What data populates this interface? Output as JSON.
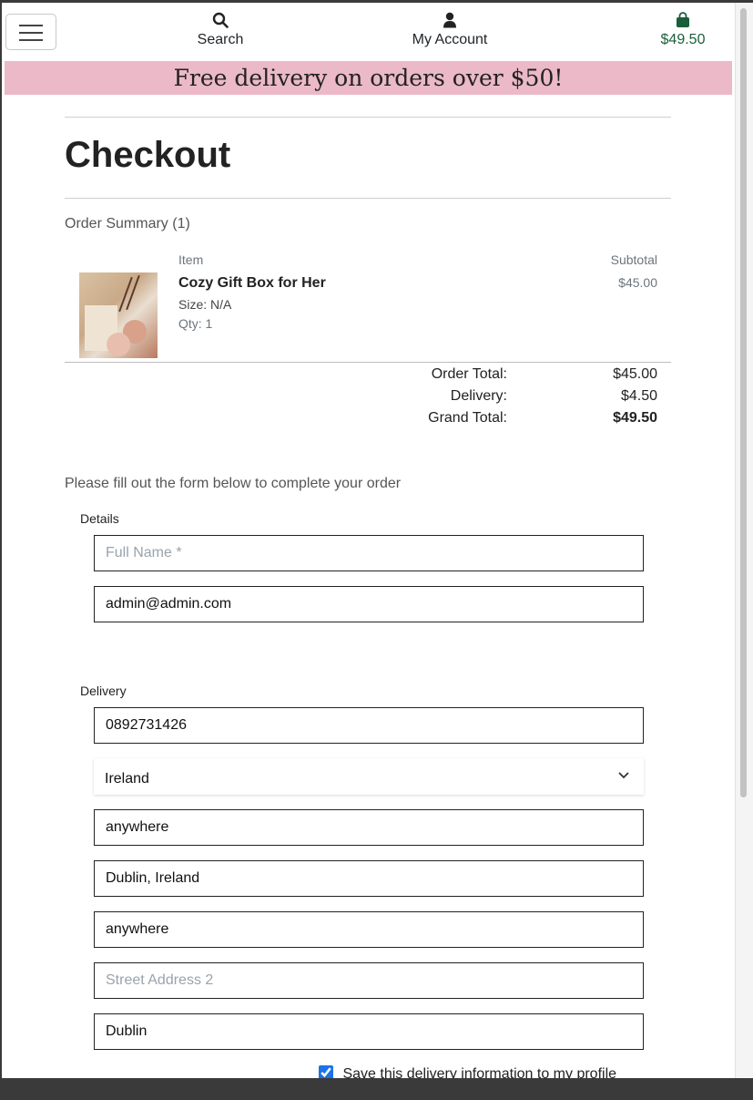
{
  "nav": {
    "search_label": "Search",
    "account_label": "My Account",
    "bag_total": "$49.50"
  },
  "banner": {
    "text": "Free delivery on orders over $50!"
  },
  "page_title": "Checkout",
  "order_summary": {
    "heading": "Order Summary (1)",
    "item_col": "Item",
    "subtotal_col": "Subtotal",
    "item": {
      "name": "Cozy Gift Box for Her",
      "size": "Size: N/A",
      "qty": "Qty: 1",
      "subtotal": "$45.00"
    },
    "totals": [
      {
        "label": "Order Total:",
        "value": "$45.00",
        "bold": false
      },
      {
        "label": "Delivery:",
        "value": "$4.50",
        "bold": false
      },
      {
        "label": "Grand Total:",
        "value": "$49.50",
        "bold": true
      }
    ]
  },
  "form": {
    "intro": "Please fill out the form below to complete your order",
    "details_legend": "Details",
    "full_name": {
      "value": "",
      "placeholder": "Full Name *"
    },
    "email": {
      "value": "admin@admin.com",
      "placeholder": ""
    },
    "delivery_legend": "Delivery",
    "phone": {
      "value": "0892731426",
      "placeholder": ""
    },
    "country": "Ireland",
    "postcode": {
      "value": "anywhere",
      "placeholder": ""
    },
    "town": {
      "value": "Dublin, Ireland",
      "placeholder": ""
    },
    "street1": {
      "value": "anywhere",
      "placeholder": ""
    },
    "street2": {
      "value": "",
      "placeholder": "Street Address 2"
    },
    "county": {
      "value": "Dublin",
      "placeholder": ""
    },
    "save_info_label": "Save this delivery information to my profile",
    "save_info_checked": true
  },
  "colors": {
    "banner_bg": "#ebb9c7",
    "bag_green": "#1b5e3b"
  }
}
